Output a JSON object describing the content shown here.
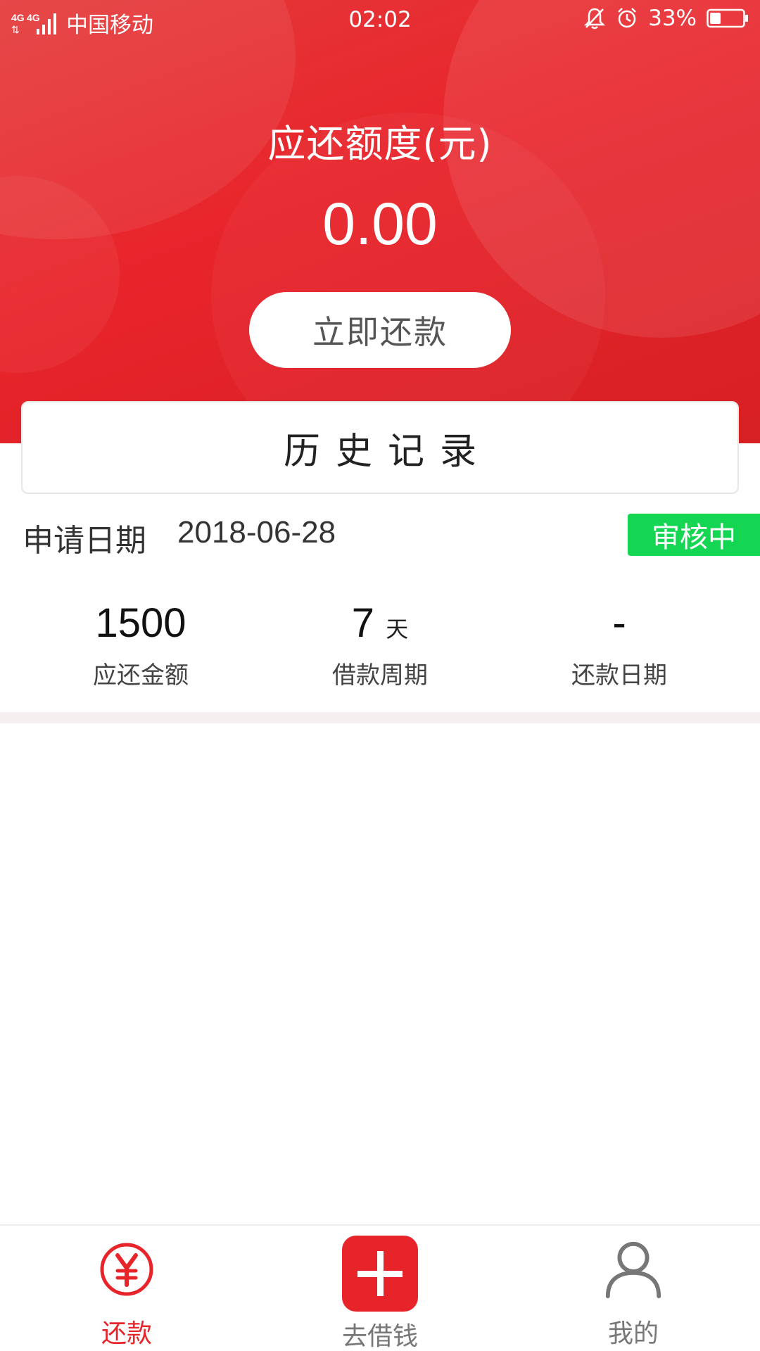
{
  "status_bar": {
    "network_label": "4G 4G",
    "carrier": "中国移动",
    "time": "02:02",
    "battery_percent": "33%"
  },
  "header": {
    "title": "应还额度(元)",
    "amount": "0.00",
    "repay_button_label": "立即还款"
  },
  "history": {
    "title": "历史记录"
  },
  "record": {
    "apply_label": "申请日期",
    "apply_date": "2018-06-28",
    "status": "审核中",
    "stats": [
      {
        "value": "1500",
        "unit": "",
        "label": "应还金额"
      },
      {
        "value": "7",
        "unit": "天",
        "label": "借款周期"
      },
      {
        "value": "-",
        "unit": "",
        "label": "还款日期"
      }
    ]
  },
  "tabs": [
    {
      "label": "还款",
      "icon": "yuan-circle-icon",
      "active": true
    },
    {
      "label": "去借钱",
      "icon": "plus-icon",
      "active": false
    },
    {
      "label": "我的",
      "icon": "user-icon",
      "active": false
    }
  ],
  "colors": {
    "primary_red": "#e8242b",
    "status_green": "#15d653",
    "inactive_tab": "#777777"
  }
}
